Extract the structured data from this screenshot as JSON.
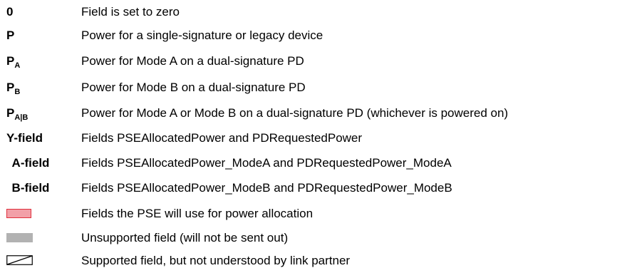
{
  "legend": {
    "rows": [
      {
        "symbol": "0",
        "description": "Field is set to zero"
      },
      {
        "symbol": "P",
        "description": "Power for a single-signature or legacy device"
      },
      {
        "symbol": "P",
        "subscript": "A",
        "description": "Power for Mode A on a dual-signature PD"
      },
      {
        "symbol": "P",
        "subscript": "B",
        "description": "Power for Mode B on a dual-signature PD"
      },
      {
        "symbol": "P",
        "subscript": "A|B",
        "description": "Power for Mode A or Mode B on a dual-signature PD (whichever is powered on)"
      },
      {
        "symbol": "Y-field",
        "description": "Fields PSEAllocatedPower and PDRequestedPower"
      },
      {
        "symbol": "A-field",
        "description": "Fields PSEAllocatedPower_ModeA and PDRequestedPower_ModeA"
      },
      {
        "symbol": "B-field",
        "description": "Fields PSEAllocatedPower_ModeB and PDRequestedPower_ModeB"
      },
      {
        "swatch": "pink-outlined-box",
        "description": "Fields the PSE will use for power allocation"
      },
      {
        "swatch": "gray-filled-box",
        "description": "Unsupported field (will not be sent out)"
      },
      {
        "swatch": "slashed-outline-box",
        "description": "Supported field, but not understood by link partner"
      }
    ]
  },
  "colors": {
    "pink_fill": "#f2a0a8",
    "pink_border": "#e0303c",
    "gray_fill": "#b2b2b2"
  }
}
